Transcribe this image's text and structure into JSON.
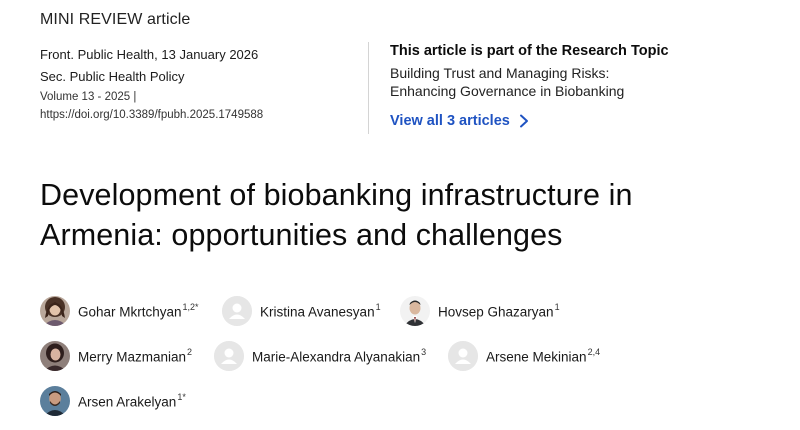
{
  "article_type": "MINI REVIEW article",
  "meta": {
    "journal_date": "Front. Public Health, 13 January 2026",
    "section": "Sec. Public Health Policy",
    "volume": "Volume 13 - 2025 |",
    "doi": "https://doi.org/10.3389/fpubh.2025.1749588"
  },
  "research_topic": {
    "heading": "This article is part of the Research Topic",
    "title": "Building Trust and Managing Risks: Enhancing Governance in Biobanking",
    "view_all": "View all 3 articles"
  },
  "article_title": "Development of biobanking infrastructure in Armenia: opportunities and challenges",
  "authors": [
    {
      "name": "Gohar Mkrtchyan",
      "affil": "1,2*",
      "avatar": "photo"
    },
    {
      "name": "Kristina Avanesyan",
      "affil": "1",
      "avatar": "placeholder"
    },
    {
      "name": "Hovsep Ghazaryan",
      "affil": "1",
      "avatar": "photo"
    },
    {
      "name": "Merry Mazmanian",
      "affil": "2",
      "avatar": "photo"
    },
    {
      "name": "Marie-Alexandra Alyanakian",
      "affil": "3",
      "avatar": "placeholder"
    },
    {
      "name": "Arsene Mekinian",
      "affil": "2,4",
      "avatar": "placeholder"
    },
    {
      "name": "Arsen Arakelyan",
      "affil": "1*",
      "avatar": "photo"
    }
  ],
  "colors": {
    "link": "#1f53c2",
    "text": "#0c0c0c",
    "divider": "#d4d4d4",
    "placeholder_avatar": "#e6e6e6"
  }
}
